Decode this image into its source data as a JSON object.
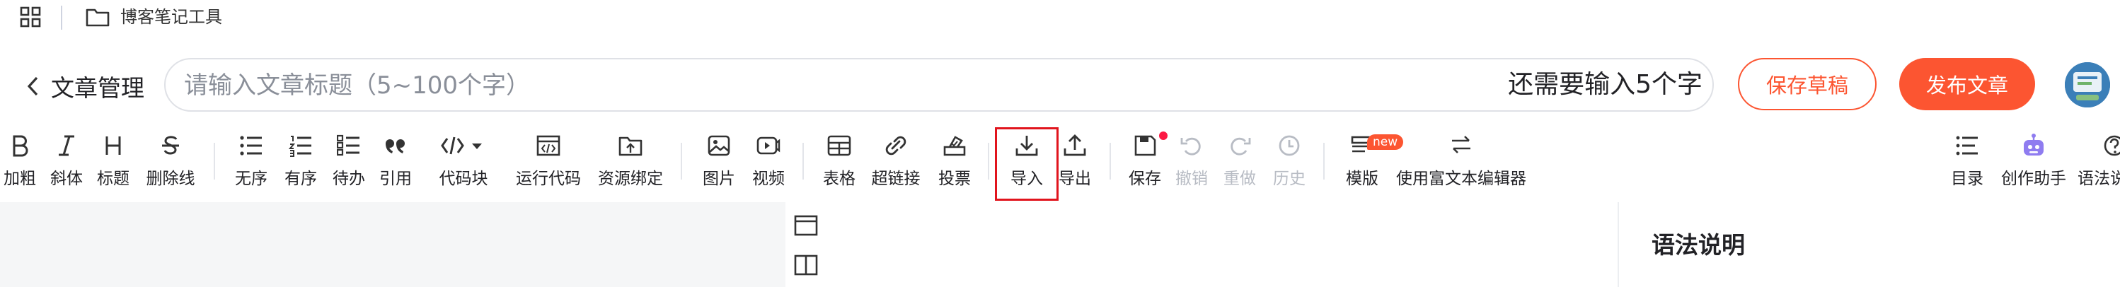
{
  "bookmark_bar": {
    "folder_label": "博客笔记工具"
  },
  "header": {
    "back_label": "文章管理",
    "title_placeholder": "请输入文章标题（5~100个字）",
    "title_value": "",
    "char_hint": "还需要输入5个字",
    "save_draft_label": "保存草稿",
    "publish_label": "发布文章"
  },
  "toolbar": {
    "items": [
      {
        "id": "bold",
        "label": "加粗",
        "icon": "bold-icon"
      },
      {
        "id": "italic",
        "label": "斜体",
        "icon": "italic-icon"
      },
      {
        "id": "heading",
        "label": "标题",
        "icon": "heading-icon"
      },
      {
        "id": "strike",
        "label": "删除线",
        "icon": "strikethrough-icon"
      },
      {
        "id": "ul",
        "label": "无序",
        "icon": "unordered-list-icon"
      },
      {
        "id": "ol",
        "label": "有序",
        "icon": "ordered-list-icon"
      },
      {
        "id": "todo",
        "label": "待办",
        "icon": "todo-list-icon"
      },
      {
        "id": "quote",
        "label": "引用",
        "icon": "quote-icon"
      },
      {
        "id": "code",
        "label": "代码块",
        "icon": "code-block-icon"
      },
      {
        "id": "run",
        "label": "运行代码",
        "icon": "run-code-icon"
      },
      {
        "id": "resource",
        "label": "资源绑定",
        "icon": "resource-bind-icon"
      },
      {
        "id": "image",
        "label": "图片",
        "icon": "image-icon"
      },
      {
        "id": "video",
        "label": "视频",
        "icon": "video-icon"
      },
      {
        "id": "table",
        "label": "表格",
        "icon": "table-icon"
      },
      {
        "id": "link",
        "label": "超链接",
        "icon": "link-icon"
      },
      {
        "id": "vote",
        "label": "投票",
        "icon": "vote-icon"
      },
      {
        "id": "import",
        "label": "导入",
        "icon": "import-icon"
      },
      {
        "id": "export",
        "label": "导出",
        "icon": "export-icon"
      },
      {
        "id": "save",
        "label": "保存",
        "icon": "save-icon"
      },
      {
        "id": "undo",
        "label": "撤销",
        "icon": "undo-icon"
      },
      {
        "id": "redo",
        "label": "重做",
        "icon": "redo-icon"
      },
      {
        "id": "history",
        "label": "历史",
        "icon": "history-icon"
      },
      {
        "id": "template",
        "label": "模版",
        "icon": "template-icon"
      },
      {
        "id": "richtext",
        "label": "使用富文本编辑器",
        "icon": "switch-editor-icon"
      },
      {
        "id": "toc",
        "label": "目录",
        "icon": "toc-icon"
      },
      {
        "id": "assistant",
        "label": "创作助手",
        "icon": "assistant-robot-icon"
      },
      {
        "id": "syntax",
        "label": "语法说",
        "icon": "help-icon"
      }
    ],
    "new_badge": "new"
  },
  "right_panel": {
    "title": "语法说明"
  },
  "colors": {
    "accent": "#fc5531",
    "highlight_box": "#e1141d",
    "editor_bg": "#f5f6f7"
  }
}
